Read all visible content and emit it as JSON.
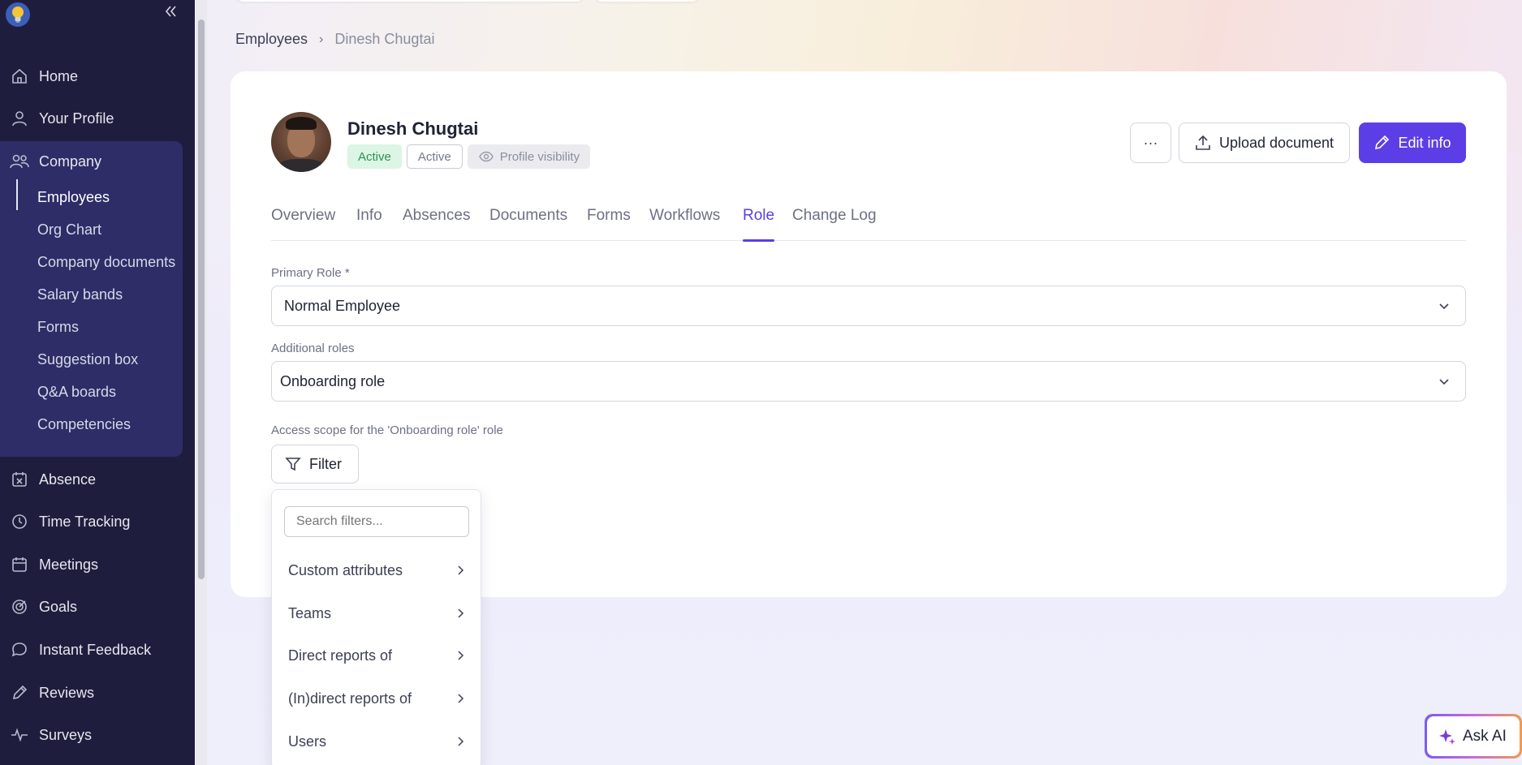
{
  "sidebar": {
    "items_top": [
      {
        "label": "Home",
        "icon": "home-icon"
      },
      {
        "label": "Your Profile",
        "icon": "user-icon"
      },
      {
        "label": "Company",
        "icon": "users-icon"
      }
    ],
    "company_sub": [
      "Employees",
      "Org Chart",
      "Company documents",
      "Salary bands",
      "Forms",
      "Suggestion box",
      "Q&A boards",
      "Competencies"
    ],
    "items_bottom": [
      {
        "label": "Absence",
        "icon": "calendar-x-icon"
      },
      {
        "label": "Time Tracking",
        "icon": "clock-icon"
      },
      {
        "label": "Meetings",
        "icon": "calendar-icon"
      },
      {
        "label": "Goals",
        "icon": "target-icon"
      },
      {
        "label": "Instant Feedback",
        "icon": "chat-icon"
      },
      {
        "label": "Reviews",
        "icon": "pencil-icon"
      },
      {
        "label": "Surveys",
        "icon": "pulse-icon"
      }
    ]
  },
  "breadcrumb": {
    "parent": "Employees",
    "separator": "›",
    "current": "Dinesh Chugtai"
  },
  "employee": {
    "name": "Dinesh Chugtai",
    "badge_status": "Active",
    "badge_active": "Active",
    "badge_visibility": "Profile visibility"
  },
  "actions": {
    "more": "···",
    "upload": "Upload document",
    "edit": "Edit info"
  },
  "tabs": [
    "Overview",
    "Info",
    "Absences",
    "Documents",
    "Forms",
    "Workflows",
    "Role",
    "Change Log"
  ],
  "active_tab": "Role",
  "role_form": {
    "primary_label": "Primary Role *",
    "primary_value": "Normal Employee",
    "additional_label": "Additional roles",
    "additional_value": "Onboarding role",
    "scope_label": "Access scope for the 'Onboarding role' role",
    "filter_button": "Filter"
  },
  "filter_menu": {
    "search_placeholder": "Search filters...",
    "items": [
      "Custom attributes",
      "Teams",
      "Direct reports of",
      "(In)direct reports of",
      "Users"
    ]
  },
  "ask_ai": "Ask AI",
  "colors": {
    "accent": "#5c3ee6",
    "sidebar": "#1f1d3d",
    "company_block": "#2e2d68",
    "active_badge_bg": "#dcf5e4"
  }
}
